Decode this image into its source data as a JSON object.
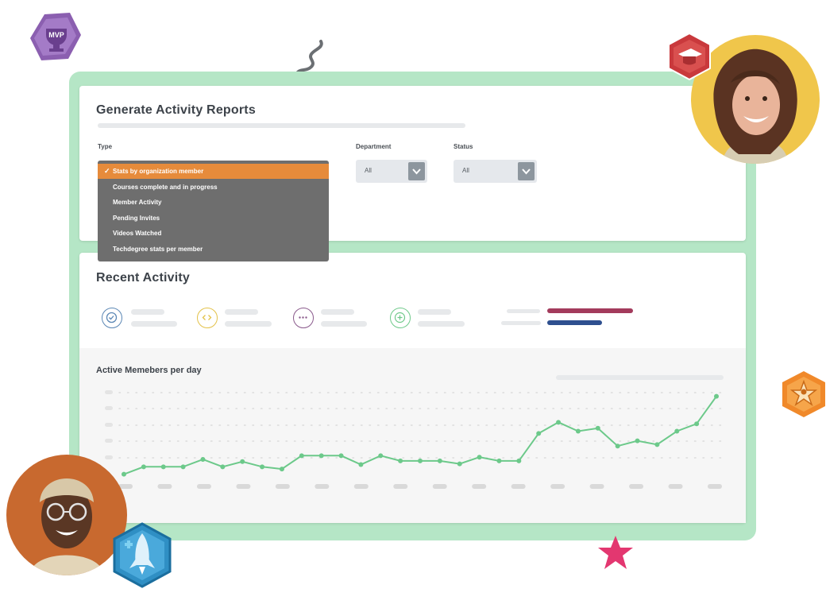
{
  "report": {
    "title": "Generate Activity Reports",
    "type_label": "Type",
    "department_label": "Department",
    "status_label": "Status",
    "department_value": "All",
    "status_value": "All",
    "type_options": [
      {
        "label": "Stats by organization member",
        "selected": true
      },
      {
        "label": "Courses complete and in progress",
        "selected": false
      },
      {
        "label": "Member Activity",
        "selected": false
      },
      {
        "label": "Pending Invites",
        "selected": false
      },
      {
        "label": "Videos Watched",
        "selected": false
      },
      {
        "label": "Techdegree stats per member",
        "selected": false
      }
    ],
    "check_glyph": "✓"
  },
  "recent": {
    "title": "Recent Activity",
    "stat_icons": [
      {
        "name": "badge-icon",
        "color": "#5b87b5"
      },
      {
        "name": "code-icon",
        "color": "#e3c24a"
      },
      {
        "name": "ellipsis-icon",
        "color": "#8a5a8c"
      },
      {
        "name": "plus-icon",
        "color": "#6fc98a"
      }
    ],
    "legend_colors": [
      "#a33b5c",
      "#2e4f8f"
    ]
  },
  "chart_data": {
    "type": "line",
    "title": "Active Memebers per day",
    "series": [
      {
        "color": "#6cc98a",
        "values": [
          1,
          2,
          2,
          2,
          3,
          2,
          2.7,
          2,
          1.7,
          3.5,
          3.5,
          3.5,
          2.3,
          3.5,
          2.8,
          2.8,
          2.8,
          2.4,
          3.3,
          2.8,
          2.8,
          6.5,
          8,
          6.8,
          7.2,
          4.8,
          5.5,
          5,
          6.8,
          7.8,
          11.5
        ]
      }
    ],
    "ylim": [
      0,
      12
    ]
  },
  "decor": {
    "mvp_badge_text": "MVP",
    "mvp_color": "#8b5fb0",
    "grad_badge_color": "#c9393c",
    "star_badge_color": "#f0892a",
    "rocket_badge_color": "#2f8fc4",
    "pink_star_color": "#e33770"
  }
}
